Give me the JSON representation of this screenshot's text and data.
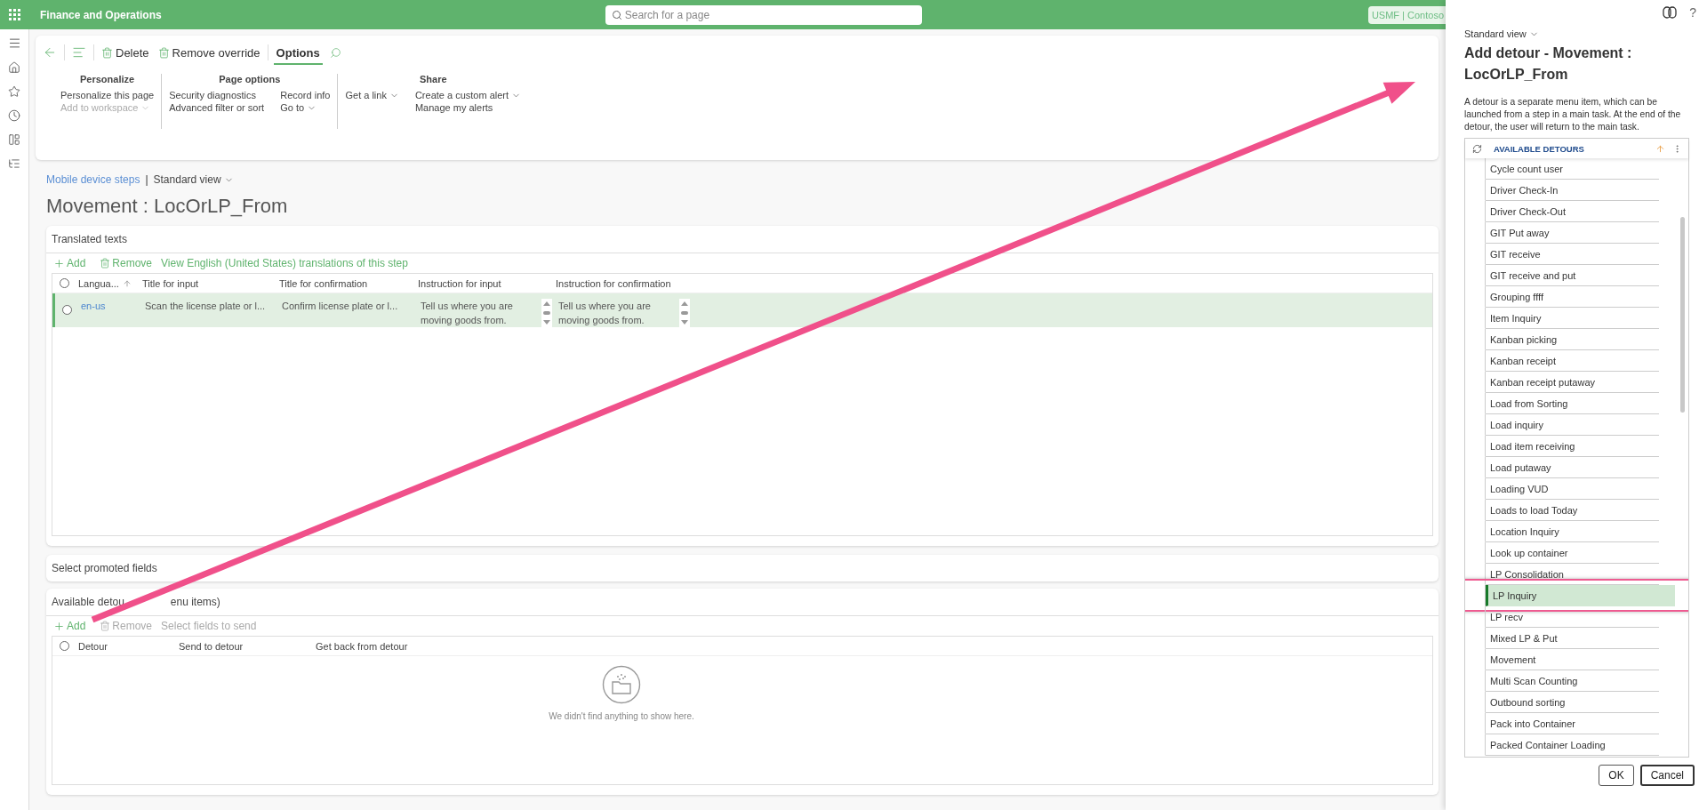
{
  "app_bar": {
    "title": "Finance and Operations",
    "search_placeholder": "Search for a page",
    "company": "USMF | Contoso"
  },
  "action_pane": {
    "buttons": [
      {
        "kind": "delete",
        "label": "Delete"
      },
      {
        "kind": "delete",
        "label": "Remove override"
      }
    ],
    "tabs": [
      {
        "label": "Options",
        "selected": true
      }
    ],
    "groups": [
      {
        "title": "Personalize",
        "columns": [
          [
            {
              "label": "Personalize this page",
              "dropdown": false,
              "disabled": false
            },
            {
              "label": "Add to workspace",
              "dropdown": true,
              "disabled": true
            }
          ]
        ]
      },
      {
        "title": "Page options",
        "columns": [
          [
            {
              "label": "Security diagnostics",
              "dropdown": false,
              "disabled": false
            },
            {
              "label": "Advanced filter or sort",
              "dropdown": false,
              "disabled": false
            }
          ],
          [
            {
              "label": "Record info",
              "dropdown": false,
              "disabled": false
            },
            {
              "label": "Go to",
              "dropdown": true,
              "disabled": false
            }
          ]
        ]
      },
      {
        "title": "Share",
        "columns": [
          [
            {
              "label": "Get a link",
              "dropdown": true,
              "disabled": false
            }
          ],
          [
            {
              "label": "Create a custom alert",
              "dropdown": true,
              "disabled": false
            },
            {
              "label": "Manage my alerts",
              "dropdown": false,
              "disabled": false
            }
          ]
        ]
      }
    ]
  },
  "page": {
    "breadcrumb": "Mobile device steps",
    "separator": "|",
    "view": "Standard view",
    "title": "Movement : LocOrLP_From"
  },
  "translated_texts": {
    "title": "Translated texts",
    "all_selected": false,
    "actions": [
      {
        "kind": "add",
        "label": "Add",
        "disabled": false
      },
      {
        "kind": "remove",
        "label": "Remove",
        "disabled": false
      },
      {
        "kind": "text",
        "label": "View English (United States) translations of this step",
        "disabled": false
      }
    ],
    "columns": [
      {
        "label": "Langua...",
        "kind": "link",
        "sorted": true
      },
      {
        "label": "Title for input",
        "kind": "text",
        "sorted": false
      },
      {
        "label": "Title for confirmation",
        "kind": "text",
        "sorted": false
      },
      {
        "label": "Instruction for input",
        "kind": "memo",
        "sorted": false
      },
      {
        "label": "Instruction for confirmation",
        "kind": "memo",
        "sorted": false
      }
    ],
    "rows": [
      {
        "selected": true,
        "cells": [
          "en-us",
          "Scan the license plate or l...",
          "Confirm license plate or l...",
          "Tell us where you are moving goods from.",
          "Tell us where you are moving goods from."
        ]
      }
    ]
  },
  "promoted_fields": {
    "title": "Select promoted fields"
  },
  "detours": {
    "title_parts": [
      "Available detou",
      "enu items)"
    ],
    "all_selected": false,
    "actions": [
      {
        "kind": "add",
        "label": "Add",
        "disabled": false
      },
      {
        "kind": "remove",
        "label": "Remove",
        "disabled": true
      },
      {
        "kind": "text",
        "label": "Select fields to send",
        "disabled": true
      }
    ],
    "columns": [
      {
        "label": "Detour"
      },
      {
        "label": "Send to detour"
      },
      {
        "label": "Get back from detour"
      }
    ],
    "empty_message": "We didn't find anything to show here."
  },
  "dialog": {
    "help": "?",
    "view": "Standard view",
    "title": "Add detour - Movement : LocOrLP_From",
    "description": "A detour is a separate menu item, which can be launched from a step in a main task. At the end of the detour, the user will return to the main task.",
    "list_header": "AVAILABLE DETOURS",
    "rows": [
      {
        "label": "Cycle count user",
        "selected": false,
        "highlighted": false
      },
      {
        "label": "Driver Check-In",
        "selected": false,
        "highlighted": false
      },
      {
        "label": "Driver Check-Out",
        "selected": false,
        "highlighted": false
      },
      {
        "label": "GIT Put away",
        "selected": false,
        "highlighted": false
      },
      {
        "label": "GIT receive",
        "selected": false,
        "highlighted": false
      },
      {
        "label": "GIT receive and put",
        "selected": false,
        "highlighted": false
      },
      {
        "label": "Grouping ffff",
        "selected": false,
        "highlighted": false
      },
      {
        "label": "Item Inquiry",
        "selected": false,
        "highlighted": false
      },
      {
        "label": "Kanban picking",
        "selected": false,
        "highlighted": false
      },
      {
        "label": "Kanban receipt",
        "selected": false,
        "highlighted": false
      },
      {
        "label": "Kanban receipt putaway",
        "selected": false,
        "highlighted": false
      },
      {
        "label": "Load from Sorting",
        "selected": false,
        "highlighted": false
      },
      {
        "label": "Load inquiry",
        "selected": false,
        "highlighted": false
      },
      {
        "label": "Load item receiving",
        "selected": false,
        "highlighted": false
      },
      {
        "label": "Load putaway",
        "selected": false,
        "highlighted": false
      },
      {
        "label": "Loading VUD",
        "selected": false,
        "highlighted": false
      },
      {
        "label": "Loads to load Today",
        "selected": false,
        "highlighted": false
      },
      {
        "label": "Location Inquiry",
        "selected": false,
        "highlighted": false
      },
      {
        "label": "Look up container",
        "selected": false,
        "highlighted": false
      },
      {
        "label": "LP Consolidation",
        "selected": false,
        "highlighted": false
      },
      {
        "label": "LP Inquiry",
        "selected": true,
        "highlighted": true
      },
      {
        "label": "LP recv",
        "selected": false,
        "highlighted": false
      },
      {
        "label": "Mixed LP & Put",
        "selected": false,
        "highlighted": false
      },
      {
        "label": "Movement",
        "selected": false,
        "highlighted": false
      },
      {
        "label": "Multi Scan Counting",
        "selected": false,
        "highlighted": false
      },
      {
        "label": "Outbound sorting",
        "selected": false,
        "highlighted": false
      },
      {
        "label": "Pack into Container",
        "selected": false,
        "highlighted": false
      },
      {
        "label": "Packed Container Loading",
        "selected": false,
        "highlighted": false
      }
    ],
    "buttons": [
      {
        "label": "OK",
        "focused": false
      },
      {
        "label": "Cancel",
        "focused": true
      }
    ]
  }
}
